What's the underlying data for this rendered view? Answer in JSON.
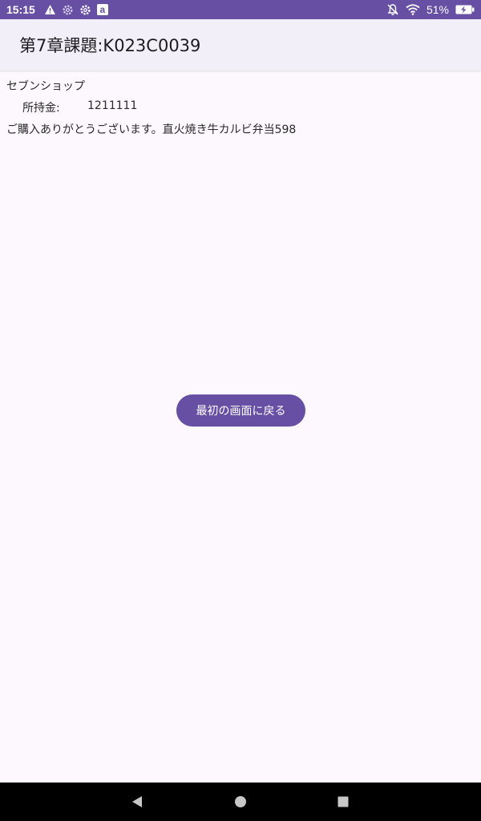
{
  "status_bar": {
    "time": "15:15",
    "battery_percent": "51%",
    "left_icons": [
      "warning-icon",
      "settings-gear-icon",
      "gear-icon",
      "amazon-icon"
    ],
    "right_icons": [
      "notifications-off-icon",
      "wifi-icon",
      "battery-charging-icon"
    ],
    "amazon_glyph": "a",
    "background_color": "#6750a4"
  },
  "app_bar": {
    "title": "第7章課題:K023C0039"
  },
  "main": {
    "shop_name": "セブンショップ",
    "balance_label": "所持金:",
    "balance_value": "1211111",
    "purchase_message": "ご購入ありがとうございます。直火焼き牛カルビ弁当598"
  },
  "back_button": {
    "label": "最初の画面に戻る",
    "color": "#6750a4"
  },
  "nav_bar": {
    "buttons": [
      "back-triangle-icon",
      "home-circle-icon",
      "recents-square-icon"
    ]
  }
}
